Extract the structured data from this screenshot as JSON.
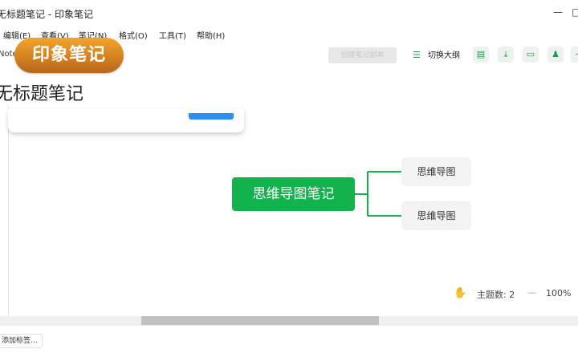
{
  "window": {
    "title": "无标题笔记 - 印象笔记",
    "minimize_glyph": "—",
    "maximize_glyph": "□"
  },
  "menu": [
    {
      "label": "编辑(E)"
    },
    {
      "label": "查看(V)"
    },
    {
      "label": "笔记(N)"
    },
    {
      "label": "格式(O)"
    },
    {
      "label": "工具(T)"
    },
    {
      "label": "帮助(H)"
    }
  ],
  "toolbar": {
    "note_label": "Note",
    "disabled_button_label": "创建笔记副本",
    "outline_label": "切换大纲",
    "icons": [
      "export-icon",
      "download-icon",
      "present-icon",
      "share-user-icon",
      "more-icon"
    ]
  },
  "logo": {
    "text": "印象笔记"
  },
  "note": {
    "title": "无标题笔记"
  },
  "mindmap": {
    "root": "思维导图笔记",
    "children": [
      "思维导图",
      "思维导图"
    ],
    "accent_color": "#12b34c"
  },
  "status": {
    "topic_count_label": "主题数: 2",
    "zoom_label": "100%"
  },
  "footer": {
    "tag_button": "添加标签..."
  }
}
